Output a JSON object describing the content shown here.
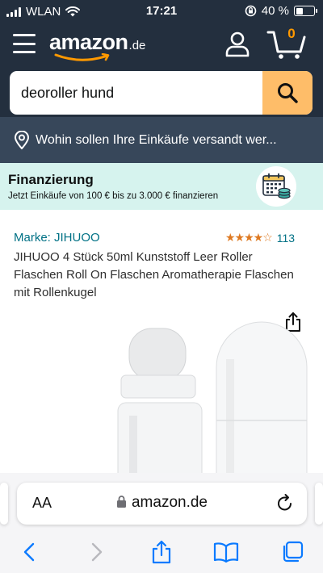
{
  "status_bar": {
    "carrier": "WLAN",
    "time": "17:21",
    "battery": "40 %"
  },
  "header": {
    "logo_word": "amazon",
    "logo_tld": ".de",
    "cart_count": "0"
  },
  "search": {
    "value": "deoroller hund"
  },
  "location": {
    "text": "Wohin sollen Ihre Einkäufe versandt wer..."
  },
  "financing": {
    "title": "Finanzierung",
    "subtitle": "Jetzt Einkäufe von 100 € bis zu 3.000 € finanzieren"
  },
  "product": {
    "brand": "Marke: JIHUOO",
    "rating_stars": 4.5,
    "rating_count": "113",
    "title": "JIHUOO 4 Stück 50ml Kunststoff Leer Roller Flaschen Roll On Flaschen Aromatherapie Flaschen mit Rollenkugel"
  },
  "browser": {
    "text_size_label": "AA",
    "domain": "amazon.de"
  },
  "colors": {
    "header_bg": "#232f3e",
    "location_bg": "#37475a",
    "search_button": "#febd69",
    "cart_accent": "#ff9900",
    "link": "#007185",
    "stars": "#de7921",
    "finance_bg": "#d6f3ee",
    "ios_blue": "#0a7aff"
  },
  "icons": {
    "menu": "hamburger-icon",
    "account": "person-icon",
    "cart": "cart-icon",
    "search": "magnifier-icon",
    "location": "pin-icon",
    "finance": "calendar-coins-icon",
    "share": "share-icon",
    "lock": "lock-icon",
    "reload": "reload-icon",
    "back": "chevron-left-icon",
    "forward": "chevron-right-icon",
    "bookmarks": "book-icon",
    "tabs": "tabs-icon"
  }
}
